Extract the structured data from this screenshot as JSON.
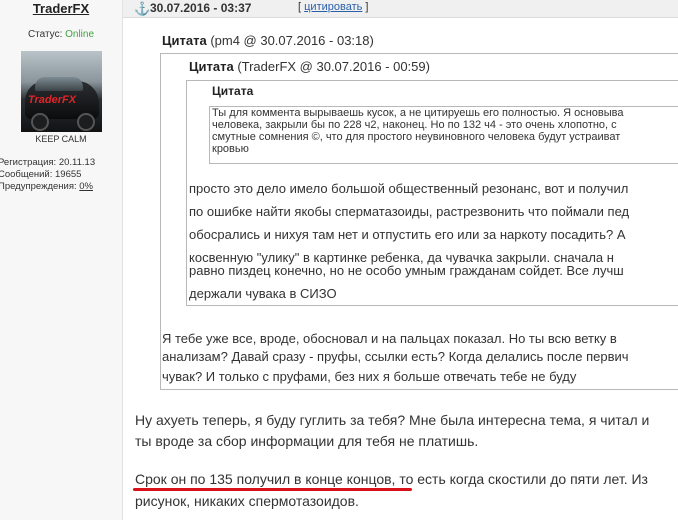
{
  "user": {
    "name": "TraderFX",
    "status_label": "Статус:",
    "status_value": "Online",
    "avatar_logo": "TraderFX",
    "user_title": "KEEP CALM",
    "stats": [
      {
        "label": "Регистрация:",
        "value": "20.11.13"
      },
      {
        "label": "Сообщений:",
        "value": "19655"
      },
      {
        "label": "Предупреждения:",
        "value": "0%"
      }
    ]
  },
  "post": {
    "anchor_icon": "anchor-icon",
    "date": "30.07.2016 - 03:37",
    "quote_bracket_open": "[",
    "quote_button": "цитировать",
    "quote_bracket_close": "]"
  },
  "quotes": {
    "q1": {
      "label": "Цитата",
      "meta": "(pm4 @ 30.07.2016 - 03:18)"
    },
    "q2": {
      "label": "Цитата",
      "meta": "(TraderFX @ 30.07.2016 - 00:59)"
    },
    "q3": {
      "label": "Цитата",
      "lines": [
        "Ты для коммента вырываешь кусок, а не цитируешь его полностью. Я основыва",
        "человека, закрыли бы по 228 ч2, наконец. Но по 132 ч4 - это очень хлопотно, с",
        "смутные сомнения ©, что для простого неувиновного человека будут устраиват",
        "кровью"
      ]
    },
    "q2_lines": [
      "просто это дело имело большой общественный резонанс, вот и получил",
      "по ошибке найти якобы сперматазоиды, растрезвонить что поймали пед",
      "обосрались и нихуя там нет и отпустить его или за наркоту посадить? А",
      "косвенную \"улику\" в картинке ребенка, да чувачка закрыли. сначала н",
      "равно пиздец конечно, но не особо умным гражданам сойдет. Все лучш",
      "держали чувака в СИЗО"
    ],
    "q1_lines": [
      "Я тебе уже все, вроде, обосновал и на пальцах показал. Но ты всю ветку в",
      "анализам? Давай сразу - пруфы, ссылки есть? Когда делались после первич",
      "чувак? И только с пруфами, без них я больше отвечать тебе не буду"
    ]
  },
  "reply": {
    "lines": [
      "Ну ахуеть теперь, я буду гуглить за тебя? Мне была интересна тема, я читал и",
      "ты вроде за сбор информации для тебя не платишь."
    ],
    "lines2": [
      "Срок он по 135 получил в конце концов, то есть когда скостили до пяти лет. Из",
      "рисунок, никаких спермотазоидов."
    ]
  },
  "colors": {
    "online": "#3fa33f",
    "link": "#2a5fa8",
    "underline": "#d8121b"
  }
}
